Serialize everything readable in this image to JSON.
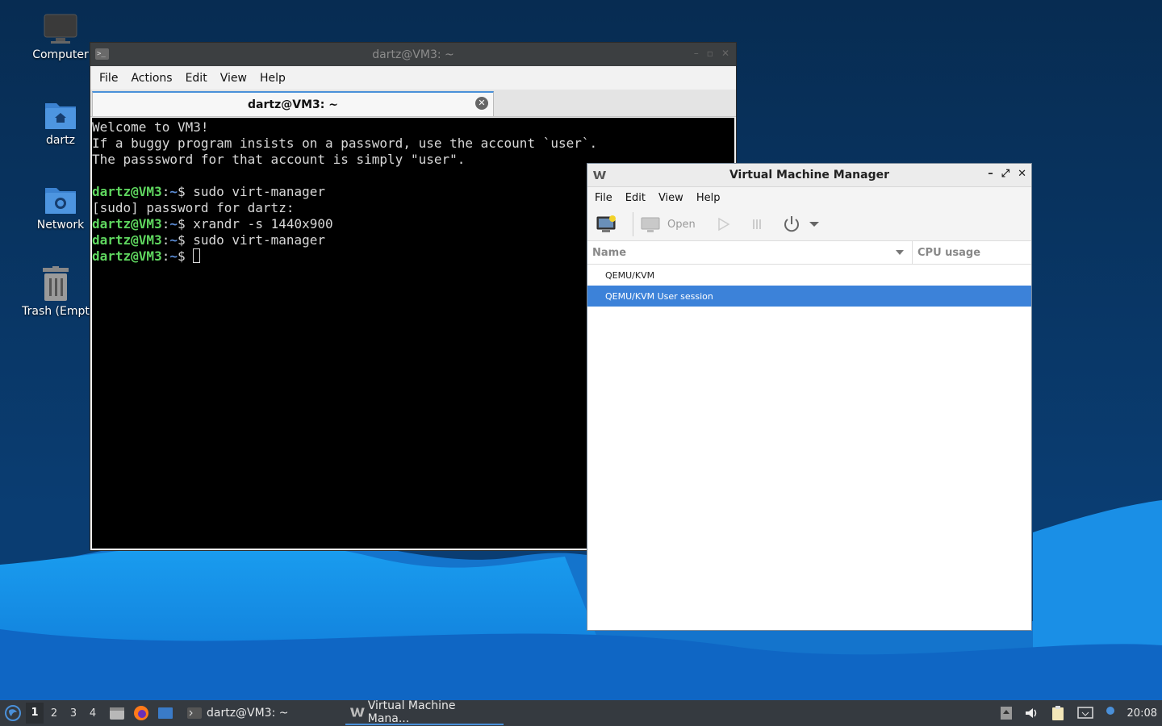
{
  "desktop": {
    "icons": [
      {
        "label": "Computer",
        "icon": "computer-icon"
      },
      {
        "label": "dartz",
        "icon": "home-folder-icon"
      },
      {
        "label": "Network",
        "icon": "network-folder-icon"
      },
      {
        "label": "Trash (Empt",
        "icon": "trash-icon"
      }
    ]
  },
  "terminal": {
    "title": "dartz@VM3: ~",
    "menu": [
      "File",
      "Actions",
      "Edit",
      "View",
      "Help"
    ],
    "tab_label": "dartz@VM3: ~",
    "lines": [
      {
        "text": "Welcome to VM3!"
      },
      {
        "text": "If a buggy program insists on a password, use the account `user`."
      },
      {
        "text": "The passsword for that account is simply \"user\"."
      },
      {
        "text": ""
      },
      {
        "user": "dartz@VM3",
        "sep": ":",
        "path": "~",
        "cmd": "$ sudo virt-manager"
      },
      {
        "text": "[sudo] password for dartz:"
      },
      {
        "user": "dartz@VM3",
        "sep": ":",
        "path": "~",
        "cmd": "$ xrandr -s 1440x900"
      },
      {
        "user": "dartz@VM3",
        "sep": ":",
        "path": "~",
        "cmd": "$ sudo virt-manager"
      },
      {
        "user": "dartz@VM3",
        "sep": ":",
        "path": "~",
        "cmd": "$ "
      }
    ]
  },
  "vmm": {
    "title": "Virtual Machine Manager",
    "menu": [
      "File",
      "Edit",
      "View",
      "Help"
    ],
    "toolbar": {
      "open_label": "Open"
    },
    "columns": {
      "name": "Name",
      "cpu": "CPU usage"
    },
    "connections": [
      {
        "name": "QEMU/KVM",
        "selected": false
      },
      {
        "name": "QEMU/KVM User session",
        "selected": true
      }
    ]
  },
  "taskbar": {
    "workspaces": [
      "1",
      "2",
      "3",
      "4"
    ],
    "active_workspace": "1",
    "tasks": [
      {
        "label": "dartz@VM3: ~",
        "icon": "terminal-icon"
      },
      {
        "label": "Virtual Machine Mana...",
        "icon": "virt-manager-icon"
      }
    ],
    "clock": "20:08"
  },
  "colors": {
    "accent": "#3c82d9",
    "prompt_user": "#5fd75f",
    "prompt_path": "#5c8dd6",
    "taskbar_bg": "#353a40"
  }
}
